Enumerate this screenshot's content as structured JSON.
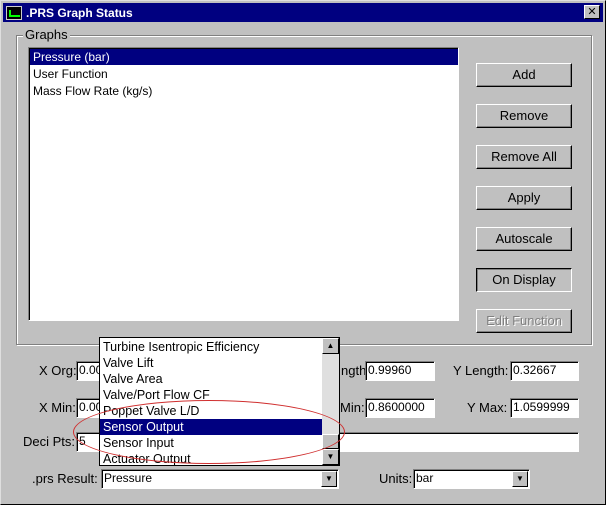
{
  "window": {
    "title": ".PRS Graph Status",
    "close_glyph": "✕"
  },
  "graphs": {
    "group_label": "Graphs",
    "items": [
      {
        "label": "Pressure (bar)",
        "selected": true
      },
      {
        "label": "User Function",
        "selected": false
      },
      {
        "label": "Mass Flow Rate (kg/s)",
        "selected": false
      }
    ]
  },
  "buttons": {
    "add": "Add",
    "remove": "Remove",
    "remove_all": "Remove All",
    "apply": "Apply",
    "autoscale": "Autoscale",
    "on_display": "On Display",
    "edit_function": "Edit Function"
  },
  "axes": {
    "x_org_label": "X Org:",
    "x_org_value": "0.00",
    "x_length_label": "ngth:",
    "x_length_value": "0.99960",
    "y_length_label": "Y Length:",
    "y_length_value": "0.32667",
    "x_min_label": "X Min:",
    "x_min_value": "0.00",
    "y_min_label": "Min:",
    "y_min_value": "0.8600000",
    "y_max_label": "Y Max:",
    "y_max_value": "1.0599999"
  },
  "deci_pts": {
    "label": "Deci Pts:",
    "value": "5"
  },
  "prs_result": {
    "label": ".prs Result:",
    "value": "Pressure",
    "dropdown_items": [
      {
        "label": "Turbine Isentropic Efficiency",
        "selected": false
      },
      {
        "label": "Valve Lift",
        "selected": false
      },
      {
        "label": "Valve Area",
        "selected": false
      },
      {
        "label": "Valve/Port Flow CF",
        "selected": false
      },
      {
        "label": "Poppet Valve L/D",
        "selected": false
      },
      {
        "label": "Sensor Output",
        "selected": true
      },
      {
        "label": "Sensor Input",
        "selected": false
      },
      {
        "label": "Actuator Output",
        "selected": false
      }
    ]
  },
  "units": {
    "label": "Units:",
    "value": "bar"
  },
  "icons": {
    "arrow_down": "▼",
    "arrow_up": "▲"
  },
  "colors": {
    "selection": "#000080",
    "annotation": "#d03030"
  }
}
